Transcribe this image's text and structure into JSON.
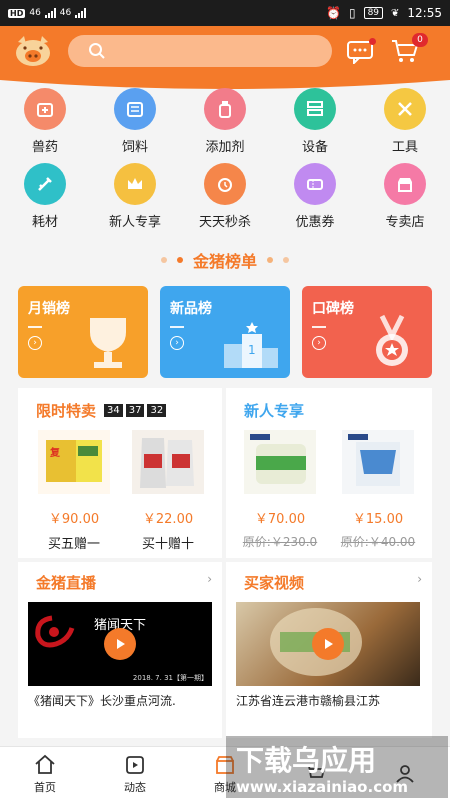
{
  "status_bar": {
    "left": "HD",
    "signal1": "46",
    "signal2": "46",
    "battery": "89",
    "time": "12:55"
  },
  "header": {
    "cart_count": "0"
  },
  "categories": [
    {
      "label": "兽药",
      "color": "#f58a6a",
      "icon": "medicine-box-icon"
    },
    {
      "label": "饲料",
      "color": "#5aa0f0",
      "icon": "feed-bag-icon"
    },
    {
      "label": "添加剂",
      "color": "#f27c8a",
      "icon": "bottle-icon"
    },
    {
      "label": "设备",
      "color": "#2dc29a",
      "icon": "server-icon"
    },
    {
      "label": "工具",
      "color": "#f5c842",
      "icon": "tools-icon"
    },
    {
      "label": "耗材",
      "color": "#2fc0c8",
      "icon": "syringe-icon"
    },
    {
      "label": "新人专享",
      "color": "#f5c040",
      "icon": "crown-icon"
    },
    {
      "label": "天天秒杀",
      "color": "#f5864a",
      "icon": "alarm-icon"
    },
    {
      "label": "优惠券",
      "color": "#c08af0",
      "icon": "coupon-icon"
    },
    {
      "label": "专卖店",
      "color": "#f57aa6",
      "icon": "store-icon"
    }
  ],
  "ranking": {
    "title": "金猪榜单",
    "cards": [
      {
        "label": "月销榜",
        "color": "#f7a02a",
        "icon": "trophy-icon"
      },
      {
        "label": "新品榜",
        "color": "#3fa6ee",
        "icon": "podium-icon"
      },
      {
        "label": "口碑榜",
        "color": "#f2624e",
        "icon": "medal-icon"
      }
    ]
  },
  "flash_sale": {
    "title": "限时特卖",
    "timer": [
      "34",
      "37",
      "32"
    ],
    "products": [
      {
        "price": "￥90.00",
        "promo": "买五赠一"
      },
      {
        "price": "￥22.00",
        "promo": "买十赠十"
      }
    ]
  },
  "newcomer": {
    "title": "新人专享",
    "products": [
      {
        "price": "￥70.00",
        "orig": "原价:￥230.0"
      },
      {
        "price": "￥15.00",
        "orig": "原价:￥40.00"
      }
    ]
  },
  "live": {
    "title": "金猪直播",
    "caption": "《猪闻天下》长沙重点河流.",
    "video_title": "猪闻天下",
    "video_date": "2018. 7. 31【第一期】"
  },
  "buyer_video": {
    "title": "买家视频",
    "caption": "江苏省连云港市赣榆县江苏"
  },
  "bottom_nav": [
    {
      "label": "首页",
      "icon": "home-icon"
    },
    {
      "label": "动态",
      "icon": "play-square-icon"
    },
    {
      "label": "商城",
      "icon": "shop-icon"
    },
    {
      "label": "",
      "icon": "cart-icon"
    },
    {
      "label": "",
      "icon": "user-icon"
    }
  ],
  "watermark": {
    "title": "下载乌应用",
    "url": "www.xiazainiao.com"
  }
}
